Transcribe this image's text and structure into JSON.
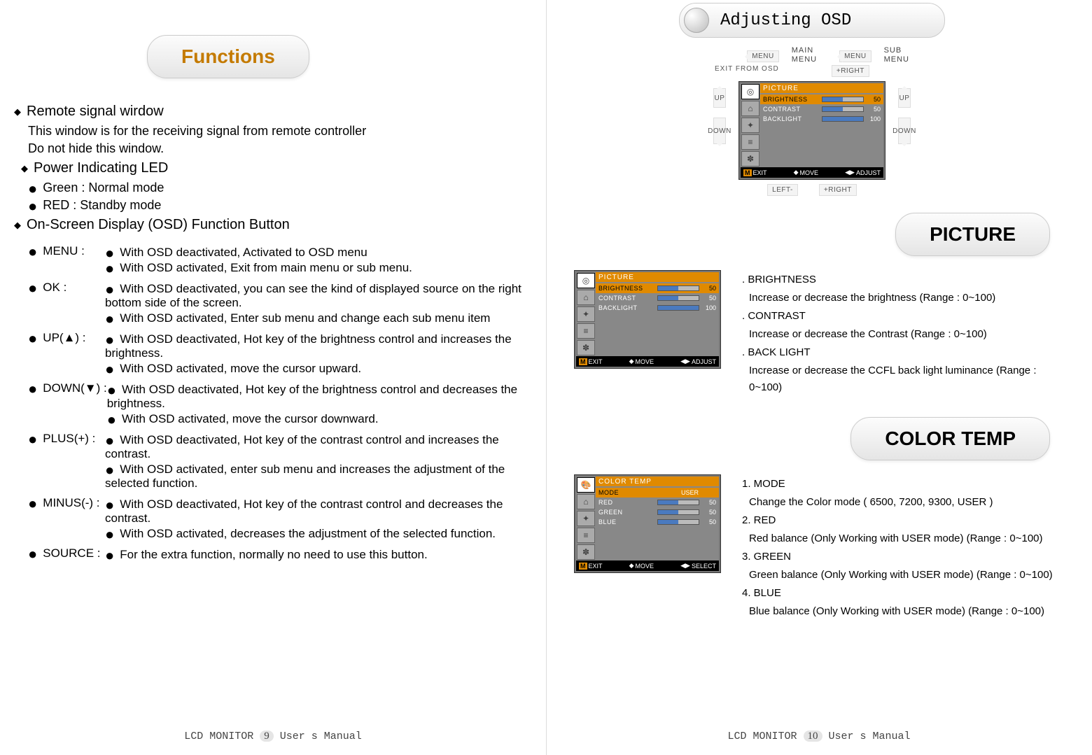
{
  "left": {
    "title": "Functions",
    "remote": {
      "heading": "Remote signal wirdow",
      "line1": "This window is for the receiving signal from remote controller",
      "line2": "Do not hide this window."
    },
    "power": {
      "heading": "Power Indicating LED",
      "green": "Green : Normal mode",
      "red": "RED : Standby mode"
    },
    "osd_heading": "On-Screen Display (OSD) Function Button",
    "menu": {
      "label": "MENU :",
      "l1": "With OSD deactivated, Activated to OSD menu",
      "l2": "With OSD activated, Exit from main menu or sub menu."
    },
    "ok": {
      "label": "OK  :",
      "l1": "With OSD deactivated, you can see the kind of displayed source on the right bottom side of the screen.",
      "l2": "With OSD activated, Enter sub menu and change each sub menu item"
    },
    "up": {
      "label": "UP(▲) :",
      "l1": "With OSD deactivated, Hot key of the brightness control and increases the brightness.",
      "l2": "With OSD activated, move the cursor upward."
    },
    "down": {
      "label": "DOWN(▼) :",
      "l1": "With OSD deactivated, Hot key of the brightness control and decreases  the brightness.",
      "l2": "With OSD activated, move the cursor downward."
    },
    "plus": {
      "label": "PLUS(+) :",
      "l1": "With OSD deactivated, Hot key of the contrast control and increases the contrast.",
      "l2": "With OSD activated, enter sub menu and increases the adjustment of the selected function."
    },
    "minus": {
      "label": "MINUS(-) :",
      "l1": "With OSD deactivated, Hot key of the contrast control and decreases the contrast.",
      "l2": "With OSD activated, decreases the adjustment of the selected function."
    },
    "source": {
      "label": "SOURCE :",
      "l1": "For the extra function, normally no need to use this button."
    },
    "footer_prefix": "LCD  MONITOR",
    "footer_suffix": "User s Manual",
    "page_no": "9"
  },
  "right": {
    "title": "Adjusting  OSD",
    "labels": {
      "menu": "MENU",
      "main_menu_l1": "MAIN",
      "main_menu_l2": "MENU",
      "sub_menu_l1": "SUB",
      "sub_menu_l2": "MENU",
      "exit_osd": "EXIT FROM OSD",
      "right": "+RIGHT",
      "left": "LEFT-",
      "up": "UP",
      "down": "DOWN"
    },
    "osd_foot": {
      "exit": "EXIT",
      "move": "MOVE",
      "adjust": "ADJUST",
      "select": "SELECT",
      "m": "M"
    },
    "picture": {
      "title": "PICTURE",
      "rows": {
        "brightness": {
          "label": "BRIGHTNESS",
          "value": "50"
        },
        "contrast": {
          "label": "CONTRAST",
          "value": "50"
        },
        "backlight": {
          "label": "BACKLIGHT",
          "value": "100"
        }
      },
      "desc": {
        "h1": ". BRIGHTNESS",
        "d1": "Increase or decrease the brightness (Range : 0~100)",
        "h2": ". CONTRAST",
        "d2": "Increase or decrease the Contrast (Range : 0~100)",
        "h3": ". BACK LIGHT",
        "d3": "Increase or decrease the CCFL back light luminance (Range : 0~100)"
      }
    },
    "colortemp": {
      "title": "COLOR TEMP",
      "rows": {
        "header": "COLOR TEMP",
        "mode": {
          "label": "MODE",
          "value": "USER"
        },
        "red": {
          "label": "RED",
          "value": "50"
        },
        "green": {
          "label": "GREEN",
          "value": "50"
        },
        "blue": {
          "label": "BLUE",
          "value": "50"
        }
      },
      "desc": {
        "h1": "1. MODE",
        "d1": "Change the Color mode ( 6500, 7200, 9300, USER )",
        "h2": "2. RED",
        "d2": "Red balance (Only Working with USER mode)  (Range : 0~100)",
        "h3": "3. GREEN",
        "d3": "Green balance (Only Working with USER mode)  (Range : 0~100)",
        "h4": "4. BLUE",
        "d4": "Blue balance (Only Working with USER mode)  (Range : 0~100)"
      }
    },
    "footer_prefix": "LCD  MONITOR",
    "footer_suffix": "User s Manual",
    "page_no": "10"
  }
}
